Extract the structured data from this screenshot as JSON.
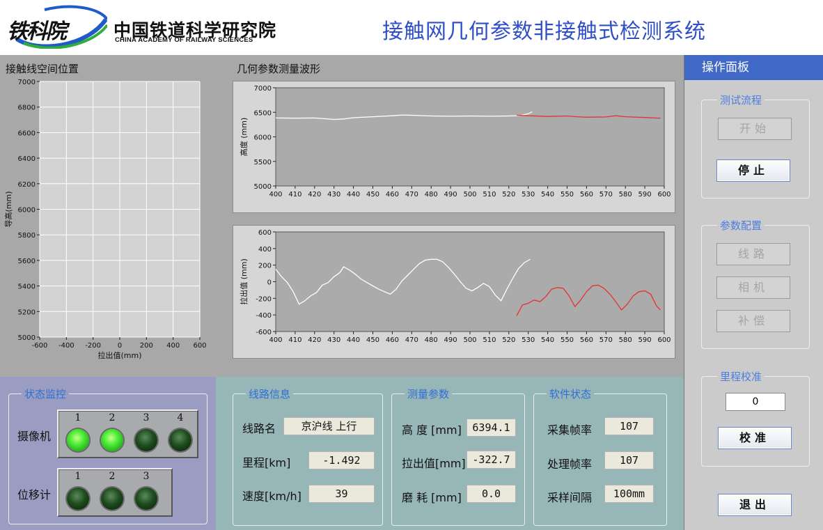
{
  "header": {
    "logo_script": "铁科院",
    "logo_cn": "中国铁道科学研究院",
    "logo_en": "CHINA ACADEMY OF RAILWAY SCIENCES",
    "app_title": "接触网几何参数非接触式检测系统"
  },
  "graphs": {
    "spatial_caption": "接触线空间位置",
    "waveform_caption": "几何参数测量波形"
  },
  "chart_data": [
    {
      "type": "scatter",
      "title": "接触线空间位置",
      "xlabel": "拉出值(mm)",
      "ylabel": "导高(mm)",
      "xlim": [
        -600,
        600
      ],
      "ylim": [
        5000,
        7000
      ],
      "xticks": [
        -600,
        -400,
        -200,
        0,
        200,
        400,
        600
      ],
      "yticks": [
        5000,
        5200,
        5400,
        5600,
        5800,
        6000,
        6200,
        6400,
        6600,
        6800,
        7000
      ],
      "grid": true,
      "points": []
    },
    {
      "type": "line",
      "title": "",
      "xlabel": "",
      "ylabel": "高度 (mm)",
      "xlim": [
        400,
        600
      ],
      "ylim": [
        5000,
        7000
      ],
      "xticks": [
        400,
        410,
        420,
        430,
        440,
        450,
        460,
        470,
        480,
        490,
        500,
        510,
        520,
        530,
        540,
        550,
        560,
        570,
        580,
        590,
        600
      ],
      "yticks": [
        5000,
        5500,
        6000,
        6500,
        7000
      ],
      "series": [
        {
          "color": "#ffffff",
          "x": [
            400,
            410,
            420,
            430,
            435,
            440,
            450,
            460,
            465,
            470,
            480,
            490,
            500,
            510,
            520,
            525,
            530,
            532
          ],
          "y": [
            6385,
            6380,
            6385,
            6355,
            6365,
            6390,
            6410,
            6430,
            6445,
            6440,
            6425,
            6420,
            6425,
            6420,
            6425,
            6430,
            6470,
            6510
          ]
        },
        {
          "color": "#e83030",
          "x": [
            524,
            530,
            540,
            550,
            555,
            560,
            570,
            575,
            580,
            590,
            595,
            598
          ],
          "y": [
            6440,
            6430,
            6415,
            6425,
            6410,
            6400,
            6405,
            6430,
            6410,
            6395,
            6385,
            6380
          ]
        }
      ]
    },
    {
      "type": "line",
      "title": "",
      "xlabel": "",
      "ylabel": "拉出值 (mm)",
      "xlim": [
        400,
        600
      ],
      "ylim": [
        -600,
        600
      ],
      "xticks": [
        400,
        410,
        420,
        430,
        440,
        450,
        460,
        470,
        480,
        490,
        500,
        510,
        520,
        530,
        540,
        550,
        560,
        570,
        580,
        590,
        600
      ],
      "yticks": [
        -600,
        -400,
        -200,
        0,
        200,
        400,
        600
      ],
      "series": [
        {
          "color": "#ffffff",
          "x": [
            400,
            403,
            406,
            409,
            412,
            415,
            418,
            421,
            424,
            427,
            430,
            433,
            435,
            438,
            441,
            444,
            447,
            450,
            453,
            456,
            459,
            462,
            465,
            468,
            471,
            474,
            477,
            480,
            483,
            486,
            489,
            492,
            495,
            498,
            501,
            504,
            507,
            510,
            513,
            516,
            519,
            522,
            525,
            528,
            531
          ],
          "y": [
            150,
            60,
            -10,
            -120,
            -270,
            -230,
            -170,
            -130,
            -40,
            -10,
            60,
            110,
            180,
            140,
            90,
            30,
            -10,
            -50,
            -90,
            -120,
            -150,
            -90,
            10,
            80,
            150,
            220,
            260,
            270,
            270,
            240,
            170,
            90,
            0,
            -80,
            -110,
            -70,
            -20,
            -60,
            -160,
            -230,
            -90,
            40,
            160,
            230,
            270
          ]
        },
        {
          "color": "#e83030",
          "x": [
            524,
            527,
            530,
            533,
            536,
            539,
            542,
            545,
            548,
            551,
            554,
            557,
            560,
            563,
            566,
            569,
            572,
            575,
            578,
            581,
            584,
            587,
            590,
            593,
            596,
            598
          ],
          "y": [
            -410,
            -280,
            -260,
            -220,
            -240,
            -180,
            -90,
            -70,
            -80,
            -170,
            -300,
            -220,
            -120,
            -50,
            -40,
            -80,
            -150,
            -240,
            -340,
            -270,
            -170,
            -120,
            -110,
            -150,
            -290,
            -340
          ]
        }
      ]
    }
  ],
  "status": {
    "title": "状态监控",
    "camera_label": "摄像机",
    "camera_leds": [
      {
        "num": "1",
        "on": true
      },
      {
        "num": "2",
        "on": true
      },
      {
        "num": "3",
        "on": false
      },
      {
        "num": "4",
        "on": false
      }
    ],
    "disp_label": "位移计",
    "disp_leds": [
      {
        "num": "1",
        "on": false
      },
      {
        "num": "2",
        "on": false
      },
      {
        "num": "3",
        "on": false
      }
    ]
  },
  "line_info": {
    "title": "线路信息",
    "name_label": "线路名",
    "name_value": "京沪线 上行",
    "mileage_label": "里程[km]",
    "mileage_value": "-1.492",
    "speed_label": "速度[km/h]",
    "speed_value": "39"
  },
  "measure": {
    "title": "测量参数",
    "height_label": "高 度 [mm]",
    "height_value": "6394.1",
    "stagger_label": "拉出值[mm]",
    "stagger_value": "-322.7",
    "wear_label": "磨 耗 [mm]",
    "wear_value": "0.0"
  },
  "software": {
    "title": "软件状态",
    "acq_label": "采集帧率",
    "acq_value": "107",
    "proc_label": "处理帧率",
    "proc_value": "107",
    "interval_label": "采样间隔",
    "interval_value": "100mm"
  },
  "panel": {
    "header": "操作面板",
    "test_title": "测试流程",
    "start_label": "开始",
    "stop_label": "停止",
    "config_title": "参数配置",
    "route_label": "线路",
    "camera_label": "相机",
    "comp_label": "补偿",
    "mileage_title": "里程校准",
    "mileage_input": "0",
    "calibrate_label": "校准",
    "exit_label": "退出"
  }
}
